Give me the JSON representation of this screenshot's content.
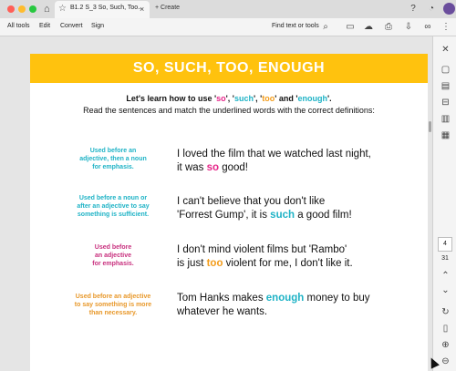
{
  "titlebar": {
    "tab_title": "B1.2 S_3 So, Such, Too...",
    "create_label": "+  Create"
  },
  "toolbar": {
    "menu": [
      "All tools",
      "Edit",
      "Convert",
      "Sign"
    ],
    "find_label": "Find text or tools"
  },
  "document": {
    "banner_title": "SO, SUCH, TOO, ENOUGH",
    "intro_prefix": "Let's learn how to use '",
    "word_so": "so",
    "word_such": "such",
    "word_too": "too",
    "word_enough": "enough",
    "sep1": "', '",
    "sep3": "' and '",
    "intro_suffix": "'.",
    "intro_line2": "Read the sentences and match the underlined words with the correct definitions:",
    "rows": [
      {
        "definition_lines": [
          "Used before an",
          "adjective, then a noun",
          "for emphasis."
        ],
        "sentence_line1": "I loved the film that we watched last night,",
        "sentence_pre": "it was ",
        "highlight": "so",
        "sentence_post": " good!"
      },
      {
        "definition_lines": [
          "Used before a noun or",
          "after an adjective to say",
          "something is sufficient."
        ],
        "sentence_line1": "I can't believe that you don't like",
        "sentence_pre": "'Forrest Gump', it is ",
        "highlight": "such",
        "sentence_post": " a good film!"
      },
      {
        "definition_lines": [
          "Used before",
          "an  adjective",
          "for emphasis."
        ],
        "sentence_line1": "I don't mind violent films but 'Rambo'",
        "sentence_pre": "is just ",
        "highlight": "too",
        "sentence_post": " violent for me, I don't like it."
      },
      {
        "definition_lines": [
          "Used before an adjective",
          "to say something is more",
          "than necessary."
        ],
        "sentence_pre": "Tom Hanks makes ",
        "highlight": "enough",
        "sentence_post": " money to buy",
        "sentence_line2": "whatever he wants."
      }
    ]
  },
  "sidepanel": {
    "page_current": "4",
    "page_total": "31"
  },
  "colors": {
    "banner": "#ffc20e",
    "pink": "#e6278a",
    "teal": "#1fb3c6",
    "orange": "#f39c1a"
  }
}
